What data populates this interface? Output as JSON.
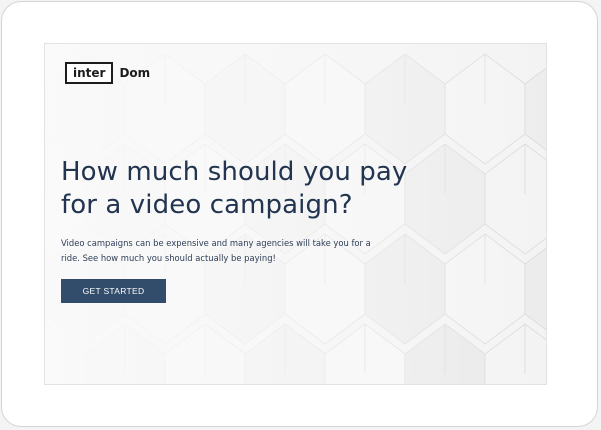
{
  "brand": {
    "logo_boxed": "inter",
    "logo_rest": "Dom"
  },
  "hero": {
    "headline_line1": "How much should you pay",
    "headline_line2": "for a video campaign?",
    "subtext_line1": "Video campaigns can be expensive and many agencies will take you for a",
    "subtext_line2": "ride. See how much you should actually be paying!",
    "cta_label": "GET STARTED"
  },
  "colors": {
    "headline": "#22344f",
    "button": "#324c6c",
    "background": "#f7f7f7"
  },
  "icons": {
    "background": "geometric-pattern"
  }
}
